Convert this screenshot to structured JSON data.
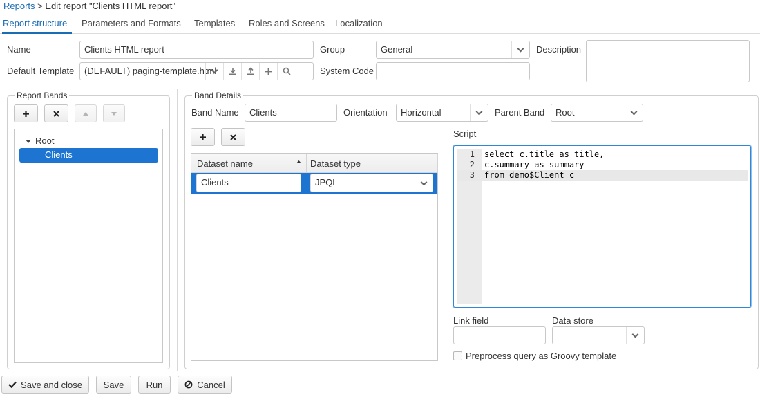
{
  "breadcrumb": {
    "root_link": "Reports",
    "separator": " > ",
    "current": "Edit report \"Clients HTML report\""
  },
  "tabs": [
    {
      "label": "Report structure",
      "active": true
    },
    {
      "label": "Parameters and Formats",
      "active": false
    },
    {
      "label": "Templates",
      "active": false
    },
    {
      "label": "Roles and Screens",
      "active": false
    },
    {
      "label": "Localization",
      "active": false
    }
  ],
  "form": {
    "name_label": "Name",
    "name_value": "Clients HTML report",
    "default_template_label": "Default Template",
    "default_template_value": "(DEFAULT) paging-template.html",
    "group_label": "Group",
    "group_value": "General",
    "system_code_label": "System Code",
    "system_code_value": "",
    "description_label": "Description",
    "description_value": ""
  },
  "report_bands": {
    "legend": "Report Bands",
    "tree": {
      "root": "Root",
      "child": "Clients"
    }
  },
  "band_details": {
    "legend": "Band Details",
    "band_name_label": "Band Name",
    "band_name_value": "Clients",
    "orientation_label": "Orientation",
    "orientation_value": "Horizontal",
    "parent_band_label": "Parent Band",
    "parent_band_value": "Root",
    "datasets": {
      "col_name": "Dataset name",
      "col_type": "Dataset type",
      "rows": [
        {
          "name": "Clients",
          "type": "JPQL"
        }
      ]
    },
    "script_label": "Script",
    "script_lines": [
      {
        "no": "1",
        "text": "select c.title as title,"
      },
      {
        "no": "2",
        "text": "c.summary as summary"
      },
      {
        "no": "3",
        "text": "from demo$Client c"
      }
    ],
    "link_field_label": "Link field",
    "link_field_value": "",
    "data_store_label": "Data store",
    "data_store_value": "",
    "preprocess_label": "Preprocess query as Groovy template"
  },
  "footer": {
    "save_close": "Save and close",
    "save": "Save",
    "run": "Run",
    "cancel": "Cancel"
  },
  "colors": {
    "accent": "#1a6cb5",
    "selection": "#1d75d1",
    "editor_focus": "#2f87d8"
  }
}
